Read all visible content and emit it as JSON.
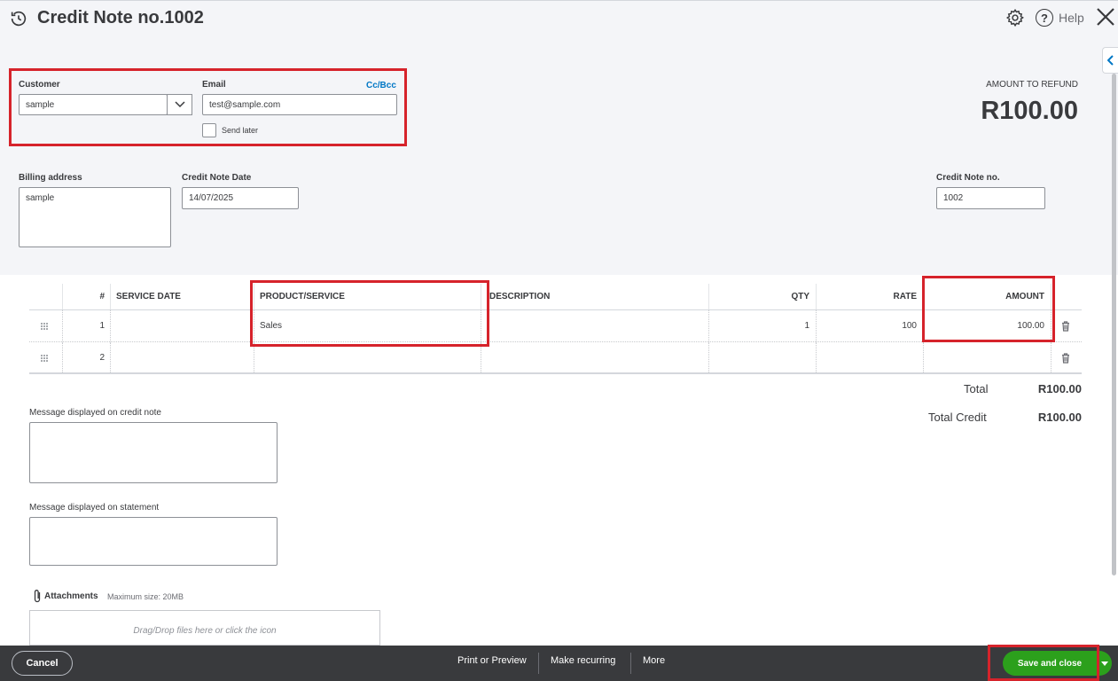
{
  "page": {
    "title": "Credit Note no.1002"
  },
  "top_actions": {
    "help_label": "Help",
    "help_symbol": "?"
  },
  "customer": {
    "label": "Customer",
    "value": "sample"
  },
  "email": {
    "label": "Email",
    "value": "test@sample.com",
    "cc_bcc": "Cc/Bcc",
    "send_later": "Send later"
  },
  "refund": {
    "label": "AMOUNT TO REFUND",
    "value": "R100.00"
  },
  "billing": {
    "label": "Billing address",
    "value": "sample"
  },
  "credit_note_date": {
    "label": "Credit Note Date",
    "value": "14/07/2025"
  },
  "credit_note_no": {
    "label": "Credit Note no.",
    "value": "1002"
  },
  "table": {
    "headers": {
      "num": "#",
      "service_date": "SERVICE DATE",
      "product": "PRODUCT/SERVICE",
      "description": "DESCRIPTION",
      "qty": "QTY",
      "rate": "RATE",
      "amount": "AMOUNT"
    },
    "rows": [
      {
        "num": "1",
        "service_date": "",
        "product": "Sales",
        "description": "",
        "qty": "1",
        "rate": "100",
        "amount": "100.00"
      },
      {
        "num": "2",
        "service_date": "",
        "product": "",
        "description": "",
        "qty": "",
        "rate": "",
        "amount": ""
      }
    ]
  },
  "totals": {
    "total_label": "Total",
    "total_value": "R100.00",
    "credit_label": "Total Credit",
    "credit_value": "R100.00"
  },
  "messages": {
    "credit_note_label": "Message displayed on credit note",
    "statement_label": "Message displayed on statement"
  },
  "attachments": {
    "label": "Attachments",
    "max_size": "Maximum size: 20MB",
    "drop_hint": "Drag/Drop files here or click the icon"
  },
  "footer": {
    "cancel": "Cancel",
    "print_preview": "Print or Preview",
    "make_recurring": "Make recurring",
    "more": "More",
    "save_close": "Save and close"
  },
  "colors": {
    "highlight": "#d6232b",
    "primary_green": "#2ca01c",
    "link_blue": "#0077c5",
    "footer_bg": "#393a3d",
    "header_bg": "#f4f5f8"
  },
  "icons": [
    "history-icon",
    "gear-icon",
    "help-icon",
    "close-icon",
    "collapse-chevron-icon",
    "chevron-down-icon",
    "drag-handle-icon",
    "trash-icon",
    "paperclip-icon",
    "caret-down-icon"
  ]
}
